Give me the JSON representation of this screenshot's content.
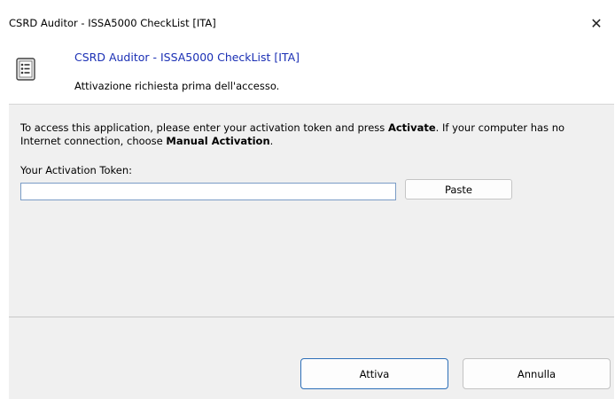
{
  "window": {
    "title": "CSRD Auditor - ISSA5000 CheckList [ITA]",
    "close_glyph": "✕",
    "close_icon": "close-icon"
  },
  "header": {
    "icon": "document-checklist-icon",
    "title": "CSRD Auditor - ISSA5000 CheckList [ITA]",
    "subtitle": "Attivazione richiesta prima dell'accesso."
  },
  "body": {
    "instructions_1": "To access this application, please enter your activation token and press ",
    "instructions_bold_1": "Activate",
    "instructions_2": ". If your computer has no Internet connection, choose ",
    "instructions_bold_2": "Manual Activation",
    "instructions_3": ".",
    "token_label": "Your Activation Token:",
    "token_value": "",
    "paste_label": "Paste"
  },
  "footer": {
    "ok_label": "Attiva",
    "cancel_label": "Annulla"
  },
  "colors": {
    "header_title": "#1a2fb4",
    "ok_border": "#2d6fb8",
    "input_border": "#7a9cc6"
  }
}
